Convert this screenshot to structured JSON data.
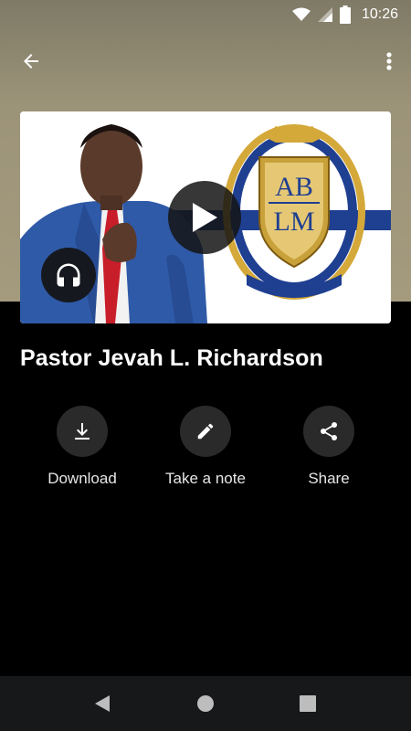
{
  "status_bar": {
    "time": "10:26"
  },
  "app_bar": {
    "back_icon": "arrow-back-icon",
    "menu_icon": "more-vert-icon"
  },
  "media": {
    "logo_letters_top": "AB",
    "logo_letters_bottom": "LM",
    "play_icon": "play-icon",
    "audio_icon": "headphones-icon"
  },
  "title": "Pastor Jevah L. Richardson",
  "actions": [
    {
      "label": "Download",
      "icon": "download-icon"
    },
    {
      "label": "Take a note",
      "icon": "pencil-icon"
    },
    {
      "label": "Share",
      "icon": "share-icon"
    }
  ],
  "nav": {
    "back": "nav-back-icon",
    "home": "nav-home-icon",
    "recents": "nav-recents-icon"
  },
  "colors": {
    "background": "#000000",
    "header_bg": "#9c9479",
    "button_bg": "#2a2a2a",
    "nav_bg": "#17181a"
  }
}
